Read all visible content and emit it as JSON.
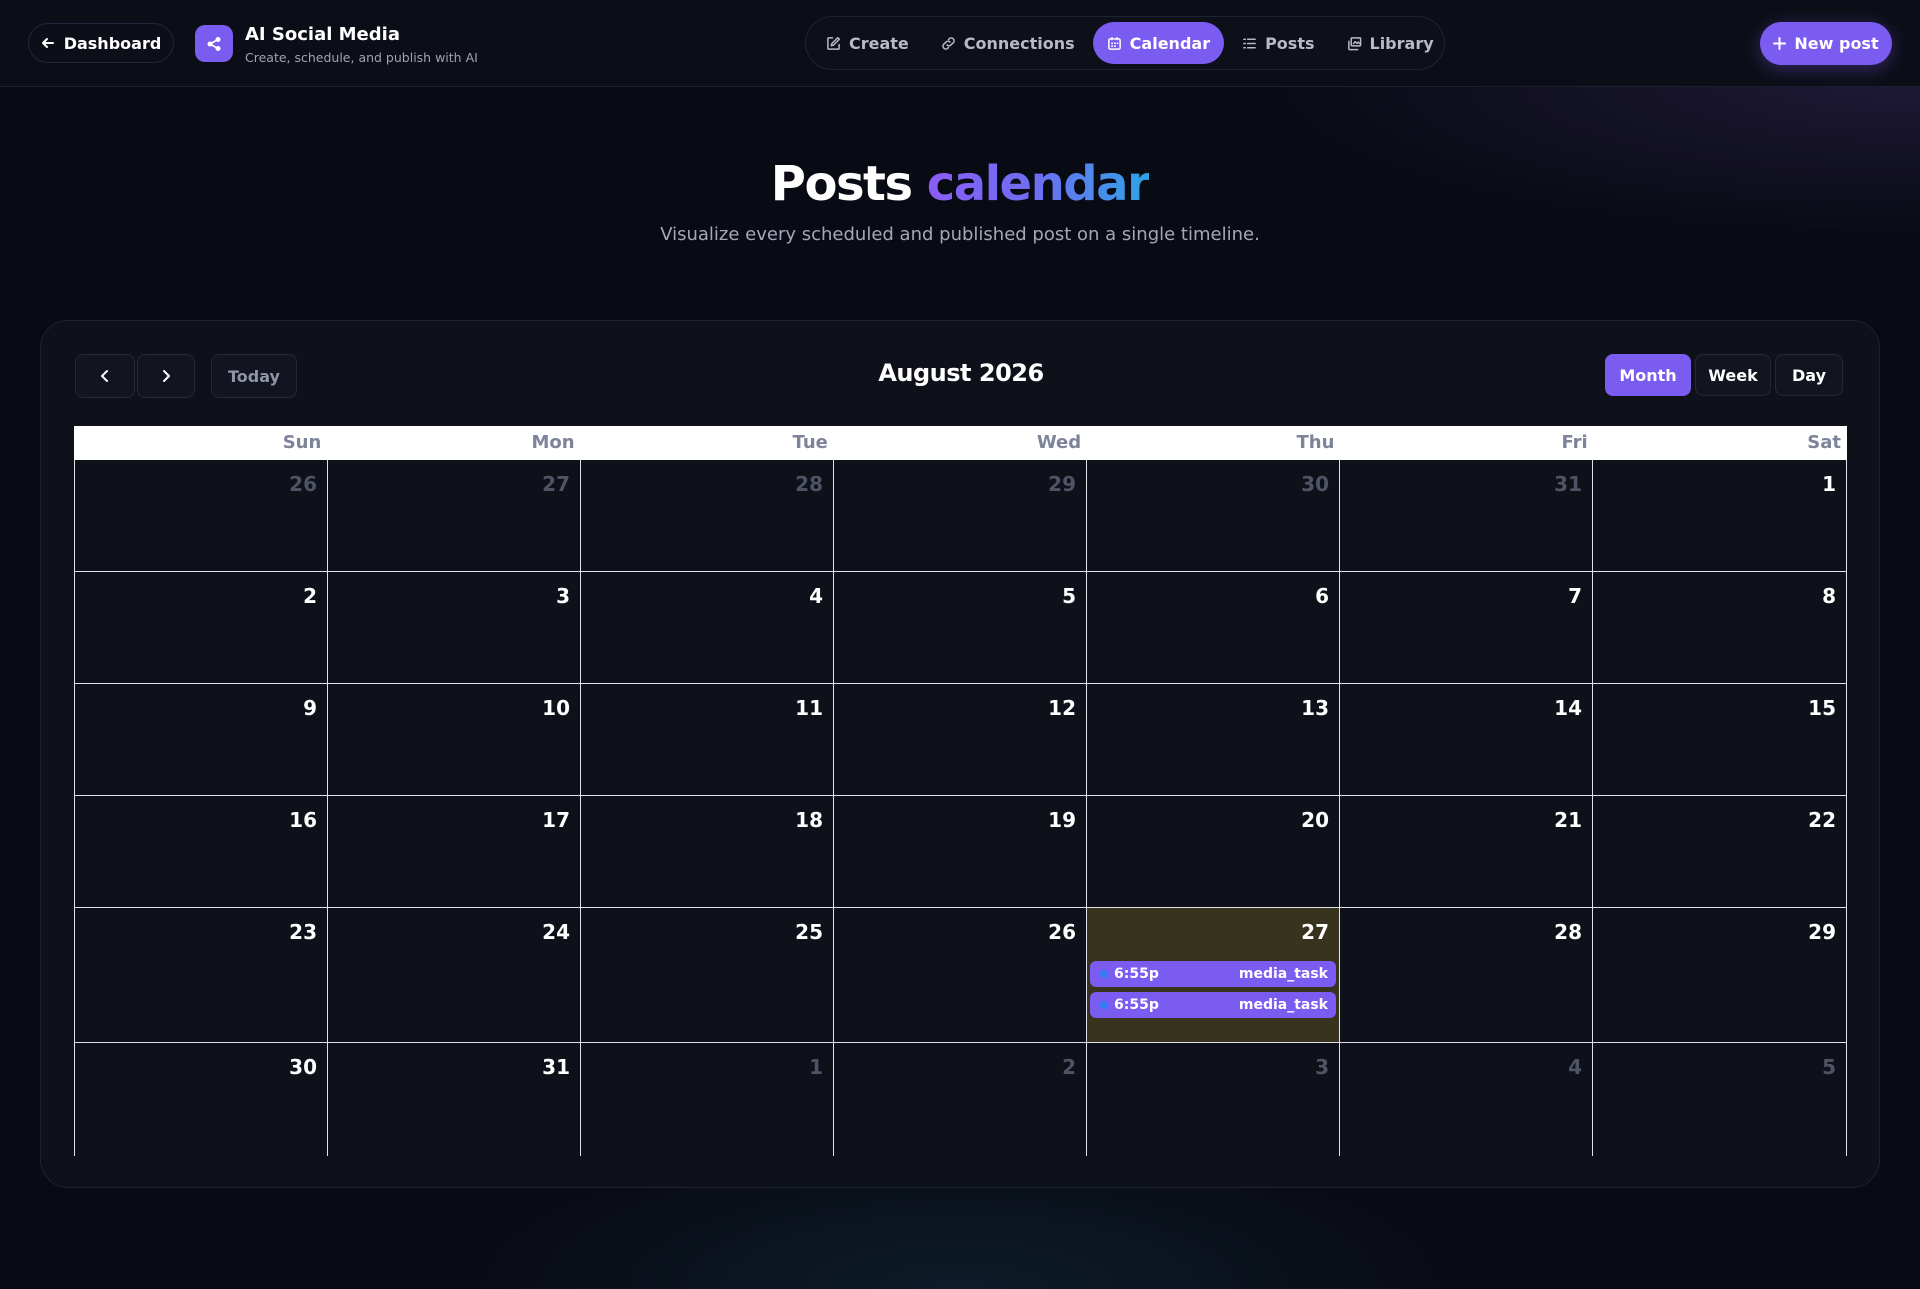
{
  "header": {
    "back_label": "Dashboard",
    "brand_name": "AI Social Media",
    "brand_tagline": "Create, schedule, and publish with AI",
    "nav": [
      {
        "label": "Create",
        "icon": "edit-icon",
        "active": false
      },
      {
        "label": "Connections",
        "icon": "link-icon",
        "active": false
      },
      {
        "label": "Calendar",
        "icon": "calendar-icon",
        "active": true
      },
      {
        "label": "Posts",
        "icon": "list-icon",
        "active": false
      },
      {
        "label": "Library",
        "icon": "library-icon",
        "active": false
      }
    ],
    "new_post_label": "New post"
  },
  "hero": {
    "title_word1": "Posts",
    "title_word2": "calendar",
    "subtitle": "Visualize every scheduled and published post on a single timeline."
  },
  "calendar": {
    "today_label": "Today",
    "month_title": "August 2026",
    "views": [
      {
        "label": "Month",
        "active": true
      },
      {
        "label": "Week",
        "active": false
      },
      {
        "label": "Day",
        "active": false
      }
    ],
    "weekdays": [
      "Sun",
      "Mon",
      "Tue",
      "Wed",
      "Thu",
      "Fri",
      "Sat"
    ],
    "days": [
      {
        "n": "26",
        "other": true
      },
      {
        "n": "27",
        "other": true
      },
      {
        "n": "28",
        "other": true
      },
      {
        "n": "29",
        "other": true
      },
      {
        "n": "30",
        "other": true
      },
      {
        "n": "31",
        "other": true
      },
      {
        "n": "1"
      },
      {
        "n": "2"
      },
      {
        "n": "3"
      },
      {
        "n": "4"
      },
      {
        "n": "5"
      },
      {
        "n": "6"
      },
      {
        "n": "7"
      },
      {
        "n": "8"
      },
      {
        "n": "9"
      },
      {
        "n": "10"
      },
      {
        "n": "11"
      },
      {
        "n": "12"
      },
      {
        "n": "13"
      },
      {
        "n": "14"
      },
      {
        "n": "15"
      },
      {
        "n": "16"
      },
      {
        "n": "17"
      },
      {
        "n": "18"
      },
      {
        "n": "19"
      },
      {
        "n": "20"
      },
      {
        "n": "21"
      },
      {
        "n": "22"
      },
      {
        "n": "23"
      },
      {
        "n": "24"
      },
      {
        "n": "25"
      },
      {
        "n": "26"
      },
      {
        "n": "27",
        "today": true,
        "events": [
          {
            "time": "6:55p",
            "name": "media_task"
          },
          {
            "time": "6:55p",
            "name": "media_task"
          }
        ]
      },
      {
        "n": "28"
      },
      {
        "n": "29"
      },
      {
        "n": "30"
      },
      {
        "n": "31"
      },
      {
        "n": "1",
        "other": true
      },
      {
        "n": "2",
        "other": true
      },
      {
        "n": "3",
        "other": true
      },
      {
        "n": "4",
        "other": true
      },
      {
        "n": "5",
        "other": true
      }
    ]
  },
  "colors": {
    "accent": "#7a5cf0",
    "today_bg": "#38331f",
    "event_dot": "#2f7df5",
    "background": "#090b14"
  }
}
